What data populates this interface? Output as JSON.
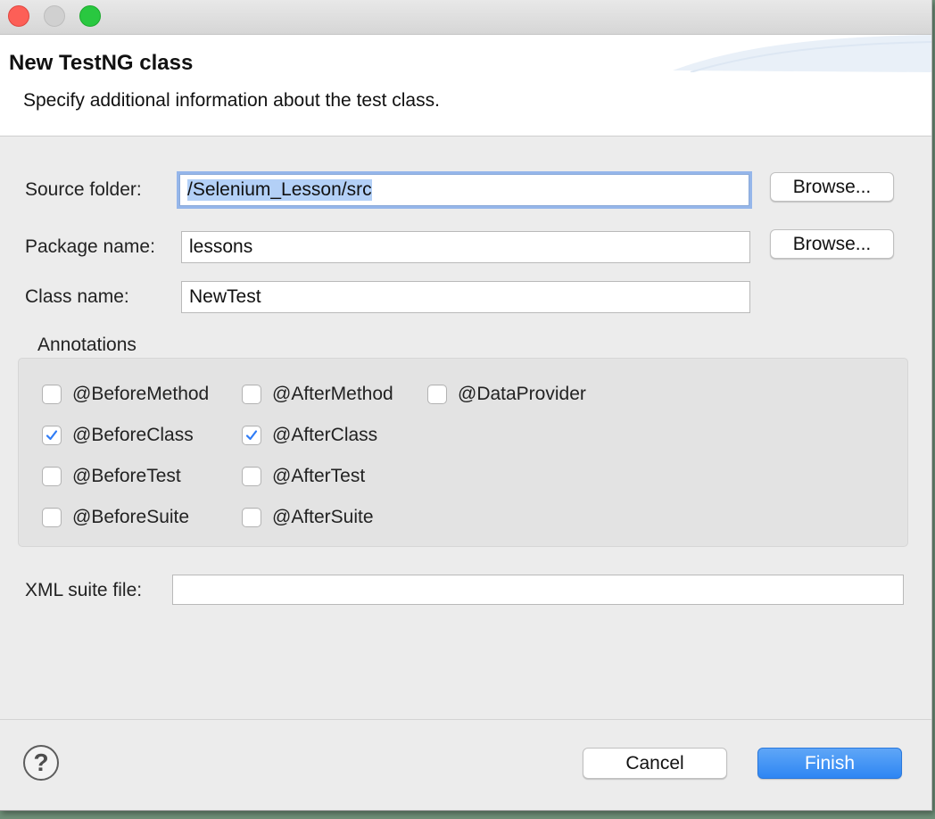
{
  "window": {
    "controls": [
      "close",
      "minimize",
      "zoom"
    ]
  },
  "banner": {
    "title": "New TestNG class",
    "description": "Specify additional information about the test class."
  },
  "form": {
    "source_folder": {
      "label": "Source folder:",
      "value": "/Selenium_Lesson/src",
      "browse_label": "Browse..."
    },
    "package_name": {
      "label": "Package name:",
      "value": "lessons",
      "browse_label": "Browse..."
    },
    "class_name": {
      "label": "Class name:",
      "value": "NewTest"
    }
  },
  "annotations": {
    "title": "Annotations",
    "items": [
      {
        "label": "@BeforeMethod",
        "checked": false
      },
      {
        "label": "@AfterMethod",
        "checked": false
      },
      {
        "label": "@DataProvider",
        "checked": false
      },
      {
        "label": "@BeforeClass",
        "checked": true
      },
      {
        "label": "@AfterClass",
        "checked": true
      },
      {
        "label": "@BeforeTest",
        "checked": false
      },
      {
        "label": "@AfterTest",
        "checked": false
      },
      {
        "label": "@BeforeSuite",
        "checked": false
      },
      {
        "label": "@AfterSuite",
        "checked": false
      }
    ]
  },
  "xml_suite": {
    "label": "XML suite file:",
    "value": ""
  },
  "footer": {
    "help_icon": "question-circle-icon",
    "cancel_label": "Cancel",
    "finish_label": "Finish"
  },
  "colors": {
    "accent": "#2e86f3",
    "close": "#fd5f57",
    "zoom": "#29c840",
    "checkbox_check": "#2f7cf6"
  }
}
